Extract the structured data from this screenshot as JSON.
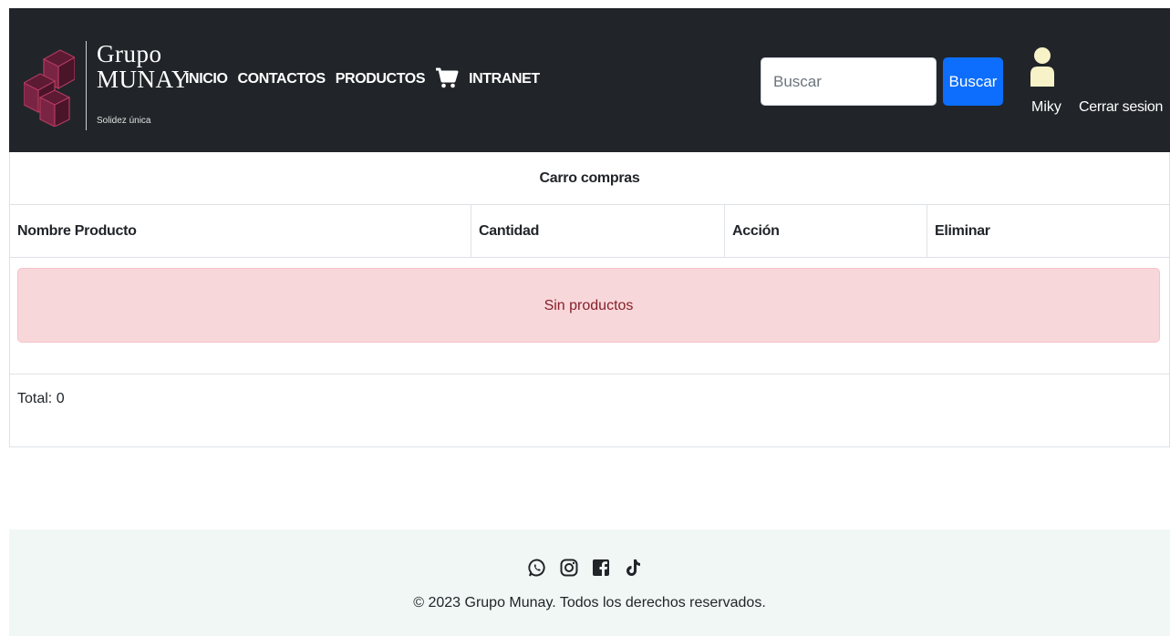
{
  "header": {
    "logo": {
      "line1": "Grupo",
      "line2": "MUNAY",
      "tagline": "Solidez única"
    },
    "nav": [
      {
        "label": "INICIO"
      },
      {
        "label": "CONTACTOS"
      },
      {
        "label": "PRODUCTOS"
      },
      {
        "label": "INTRANET"
      }
    ],
    "cart_icon": "shopping-cart-icon",
    "search": {
      "placeholder": "Buscar",
      "value": "",
      "button_label": "Buscar"
    },
    "user": {
      "icon": "user-icon",
      "name": "Miky",
      "logout_label": "Cerrar sesion"
    }
  },
  "cart": {
    "title": "Carro compras",
    "columns": [
      "Nombre Producto",
      "Cantidad",
      "Acción",
      "Eliminar"
    ],
    "empty_message": "Sin productos",
    "total_label": "Total: 0"
  },
  "footer": {
    "social_icons": [
      "whatsapp-icon",
      "instagram-icon",
      "facebook-icon",
      "tiktok-icon"
    ],
    "copyright": "© 2023 Grupo Munay. Todos los derechos reservados."
  },
  "colors": {
    "navbar_bg": "#212529",
    "accent_blue": "#0d6efd",
    "alert_bg": "#f8d7da",
    "alert_text": "#842029",
    "footer_bg": "#f1f7f5",
    "logo_cube": "#8b2a4a"
  }
}
